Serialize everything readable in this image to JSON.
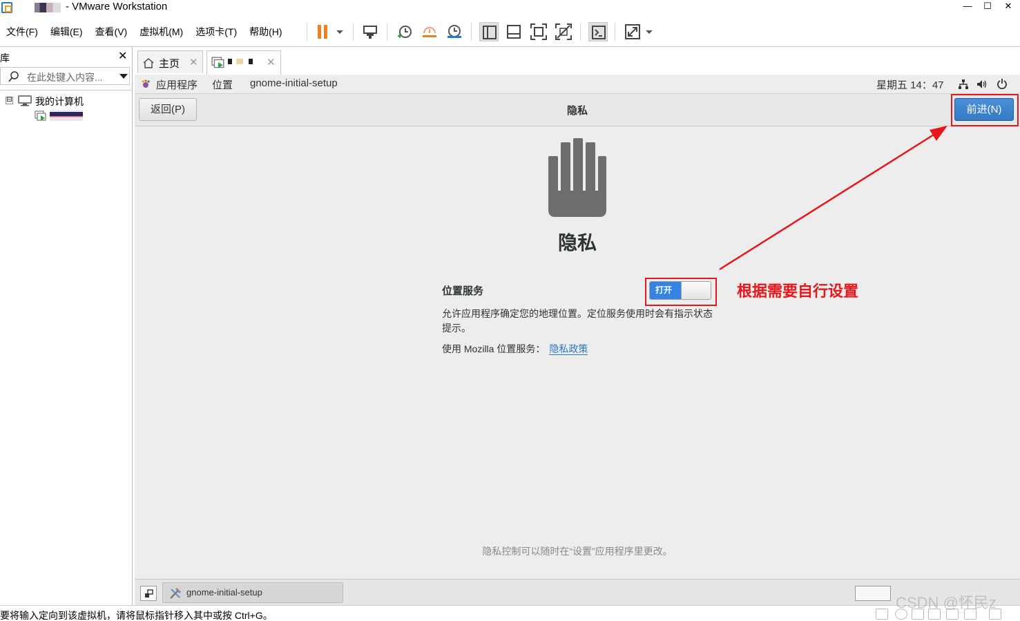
{
  "window": {
    "title": "- VMware Workstation",
    "minimize": "—",
    "maximize": "☐",
    "close": "✕"
  },
  "menubar": {
    "items": [
      "文件(F)",
      "编辑(E)",
      "查看(V)",
      "虚拟机(M)",
      "选项卡(T)",
      "帮助(H)"
    ]
  },
  "toolbar": {
    "icons": [
      "pause-icon",
      "send-ctrl-alt-del-icon",
      "snapshot-icon",
      "revert-snapshot-icon",
      "snapshot-manager-icon",
      "normal-view-icon",
      "console-view-icon",
      "full-screen-icon",
      "unity-icon",
      "terminal-icon",
      "stretch-icon"
    ]
  },
  "library": {
    "title": "库",
    "close": "✕",
    "search_placeholder": "在此处键入内容...",
    "tree": {
      "toggle": "⊟",
      "root_label": "我的计算机"
    }
  },
  "tabs": {
    "home_label": "主页",
    "close": "✕"
  },
  "guest": {
    "topbar": {
      "applications": "应用程序",
      "places": "位置",
      "app_name": "gnome-initial-setup",
      "clock": "星期五 14：47"
    },
    "header": {
      "back": "返回(P)",
      "title": "隐私",
      "next": "前进(N)"
    },
    "page": {
      "heading": "隐私",
      "location_label": "位置服务",
      "switch_label": "打开",
      "switch_state": "on",
      "description": "允许应用程序确定您的地理位置。定位服务使用时会有指示状态提示。",
      "mozilla_text": "使用 Mozilla 位置服务：",
      "privacy_link": "隐私政策",
      "footer_note": "隐私控制可以随时在“设置”应用程序里更改。"
    },
    "taskbar": {
      "item_label": "gnome-initial-setup"
    }
  },
  "annotation": {
    "text": "根据需要自行设置",
    "color": "#e8161a"
  },
  "statusbar": {
    "text": "要将输入定向到该虚拟机，请将鼠标指针移入其中或按 Ctrl+G。",
    "watermark": "CSDN @怀民z"
  },
  "colors": {
    "accent_blue": "#3584e4",
    "pause_orange": "#f0811e"
  }
}
